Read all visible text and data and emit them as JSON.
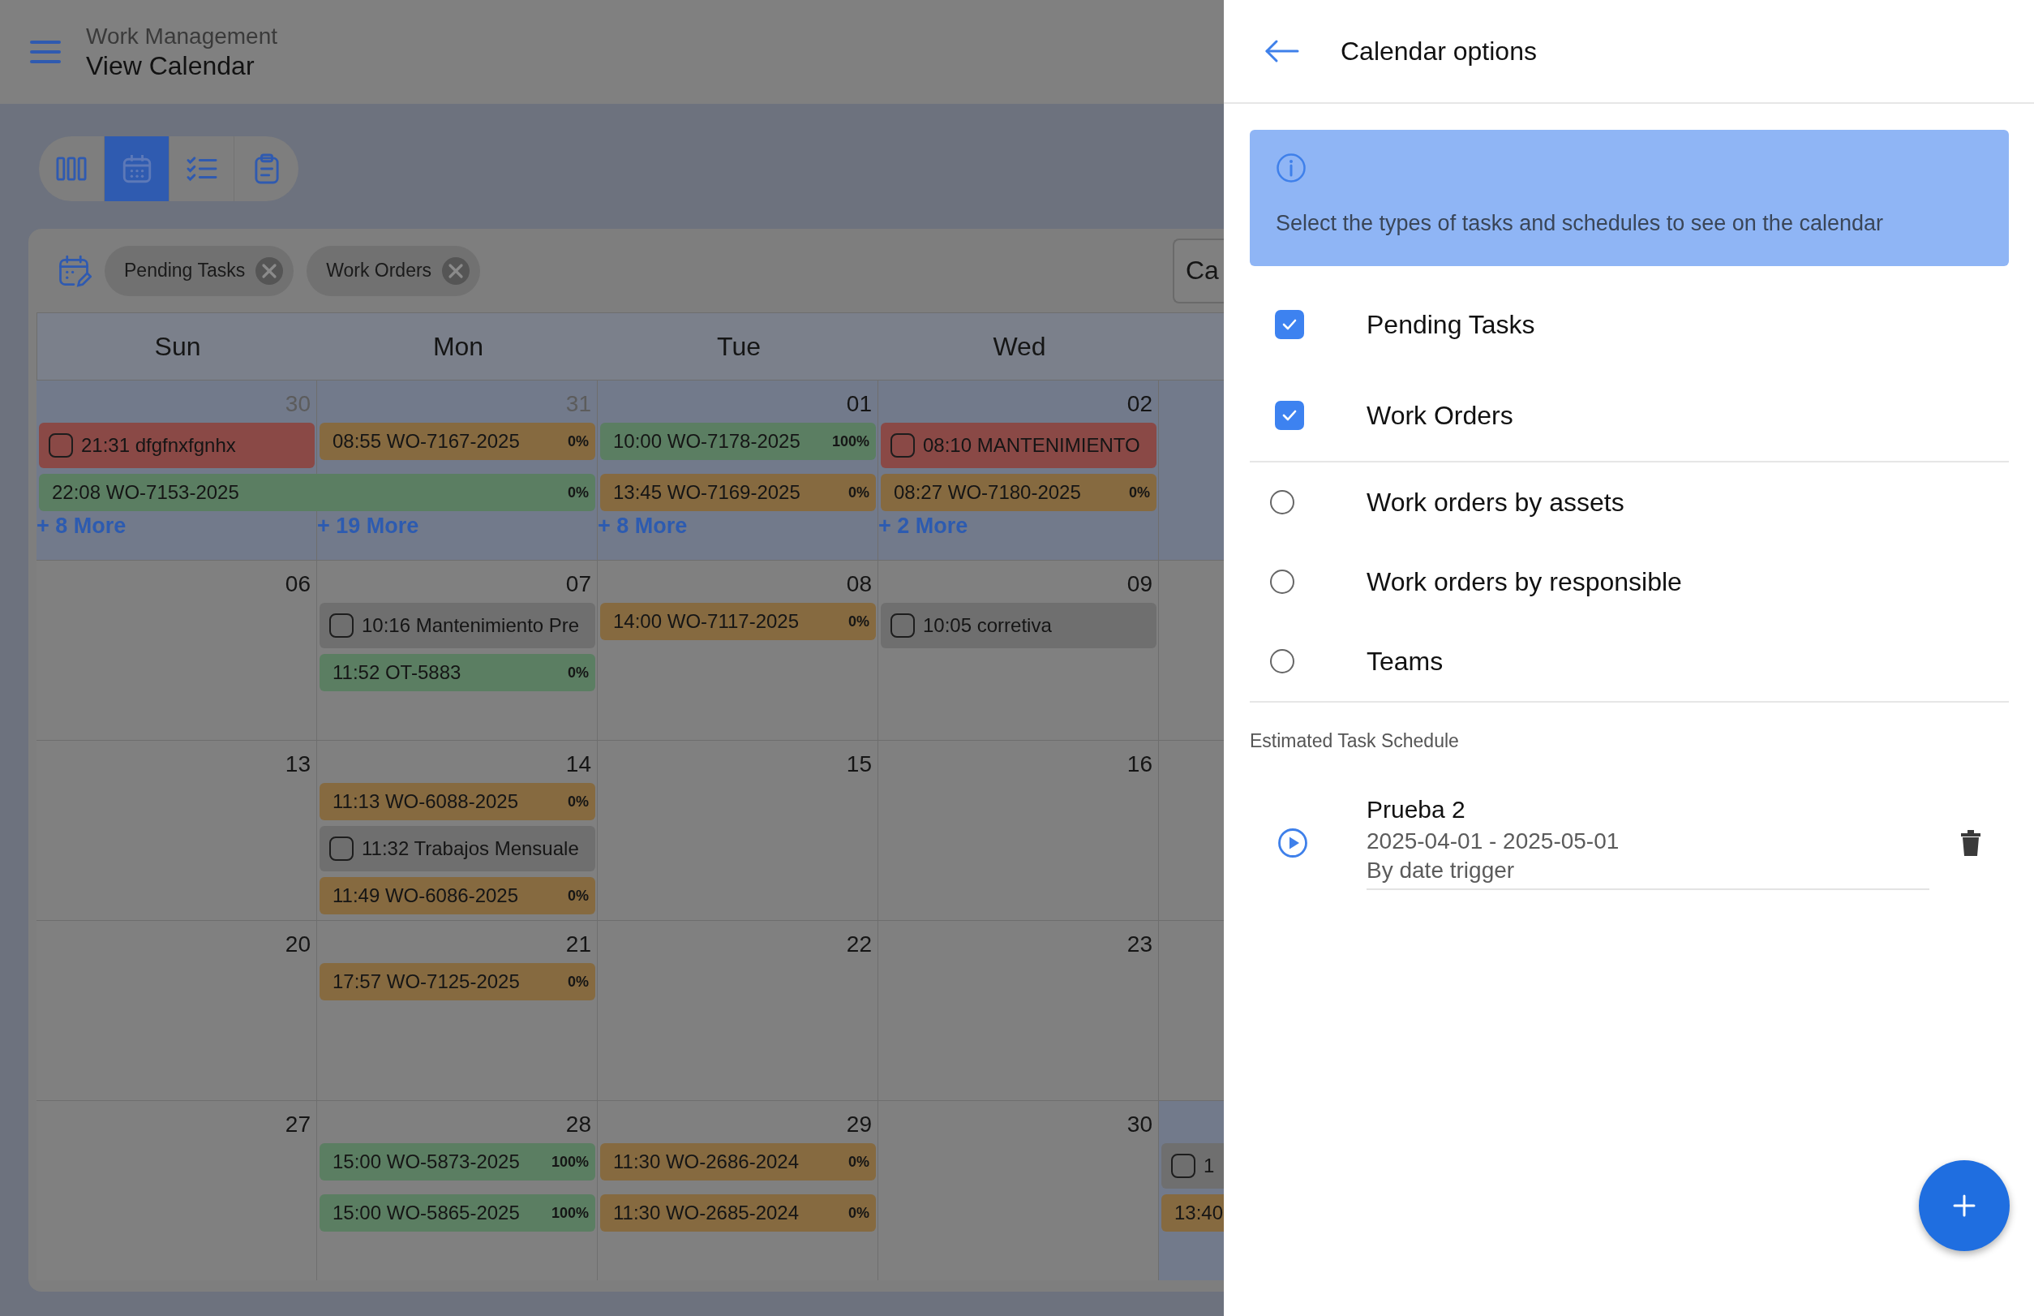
{
  "header": {
    "app": "Work Management",
    "title": "View Calendar"
  },
  "view_modes": [
    {
      "kind": "columns",
      "selected": false
    },
    {
      "kind": "calendar",
      "selected": true
    },
    {
      "kind": "checklist",
      "selected": false
    },
    {
      "kind": "clipboard",
      "selected": false
    }
  ],
  "filters": {
    "chips": [
      {
        "label": "Pending Tasks"
      },
      {
        "label": "Work Orders"
      }
    ],
    "button": "Ca"
  },
  "calendar": {
    "weekdays": [
      "Sun",
      "Mon",
      "Tue",
      "Wed"
    ],
    "weeks": [
      {
        "days": [
          {
            "date": "30",
            "muted": true,
            "shaded": true,
            "more": "+ 8 More",
            "events": [
              {
                "kind": "task",
                "text": "21:31 dfgfnxfgnhx",
                "color": "#8a4946"
              },
              {
                "kind": "order",
                "text": "22:08 WO-7153-2025",
                "progress": "0%",
                "color": "#5b7e62",
                "multi_day": true
              }
            ]
          },
          {
            "date": "31",
            "muted": true,
            "shaded": true,
            "more": "+ 19 More",
            "events": [
              {
                "kind": "order",
                "text": "08:55 WO-7167-2025",
                "progress": "0%",
                "color": "#866a40"
              }
            ]
          },
          {
            "date": "01",
            "muted": false,
            "shaded": true,
            "more": "+ 8 More",
            "events": [
              {
                "kind": "order",
                "text": "10:00 WO-7178-2025",
                "progress": "100%",
                "color": "#5b7e62"
              },
              {
                "kind": "order",
                "text": "13:45 WO-7169-2025",
                "progress": "0%",
                "color": "#866a40"
              }
            ]
          },
          {
            "date": "02",
            "muted": false,
            "shaded": true,
            "more": "+ 2 More",
            "events": [
              {
                "kind": "task",
                "text": "08:10 MANTENIMIENTO",
                "color": "#8a4946"
              },
              {
                "kind": "order",
                "text": "08:27 WO-7180-2025",
                "progress": "0%",
                "color": "#866a40"
              }
            ]
          },
          {
            "shaded": true
          }
        ]
      },
      {
        "days": [
          {
            "date": "06",
            "muted": false,
            "shaded": false
          },
          {
            "date": "07",
            "muted": false,
            "shaded": false,
            "events": [
              {
                "kind": "task",
                "text": "10:16 Mantenimiento Pre",
                "color": "#6f6f6f"
              },
              {
                "kind": "order",
                "text": "11:52 OT-5883",
                "progress": "0%",
                "color": "#5b7e62"
              }
            ]
          },
          {
            "date": "08",
            "muted": false,
            "shaded": false,
            "events": [
              {
                "kind": "order",
                "text": "14:00 WO-7117-2025",
                "progress": "0%",
                "color": "#866a40"
              }
            ]
          },
          {
            "date": "09",
            "muted": false,
            "shaded": false,
            "events": [
              {
                "kind": "task",
                "text": "10:05 corretiva",
                "color": "#6f6f6f"
              }
            ]
          }
        ]
      },
      {
        "days": [
          {
            "date": "13",
            "muted": false,
            "shaded": false
          },
          {
            "date": "14",
            "muted": false,
            "shaded": false,
            "events": [
              {
                "kind": "order",
                "text": "11:13 WO-6088-2025",
                "progress": "0%",
                "color": "#866a40"
              },
              {
                "kind": "task",
                "text": "11:32 Trabajos Mensuale",
                "color": "#6f6f6f"
              },
              {
                "kind": "order",
                "text": "11:49 WO-6086-2025",
                "progress": "0%",
                "color": "#866a40"
              }
            ]
          },
          {
            "date": "15",
            "muted": false,
            "shaded": false
          },
          {
            "date": "16",
            "muted": false,
            "shaded": false
          }
        ]
      },
      {
        "days": [
          {
            "date": "20",
            "muted": false,
            "shaded": false
          },
          {
            "date": "21",
            "muted": false,
            "shaded": false,
            "events": [
              {
                "kind": "order",
                "text": "17:57 WO-7125-2025",
                "progress": "0%",
                "color": "#866a40"
              }
            ]
          },
          {
            "date": "22",
            "muted": false,
            "shaded": false
          },
          {
            "date": "23",
            "muted": false,
            "shaded": false
          }
        ]
      },
      {
        "days": [
          {
            "date": "27",
            "muted": false,
            "shaded": false
          },
          {
            "date": "28",
            "muted": false,
            "shaded": false,
            "events": [
              {
                "kind": "order",
                "text": "15:00 WO-5873-2025",
                "progress": "100%",
                "color": "#5b7e62"
              },
              {
                "kind": "order",
                "text": "15:00 WO-5865-2025",
                "progress": "100%",
                "color": "#5b7e62"
              }
            ]
          },
          {
            "date": "29",
            "muted": false,
            "shaded": false,
            "events": [
              {
                "kind": "order",
                "text": "11:30 WO-2686-2024",
                "progress": "0%",
                "color": "#866a40"
              },
              {
                "kind": "order",
                "text": "11:30 WO-2685-2024",
                "progress": "0%",
                "color": "#866a40"
              }
            ]
          },
          {
            "date": "30",
            "muted": false,
            "shaded": false
          },
          {
            "shaded": true,
            "events": [
              {
                "kind": "task",
                "text": "1",
                "color": "#6f6f6f"
              },
              {
                "kind": "order",
                "text": "13:40",
                "color": "#866a40"
              }
            ]
          }
        ]
      }
    ]
  },
  "drawer": {
    "title": "Calendar options",
    "info": "Select the types of tasks and schedules to see on the calendar",
    "options": [
      {
        "kind": "checkbox",
        "label": "Pending Tasks",
        "checked": true
      },
      {
        "kind": "checkbox",
        "label": "Work Orders",
        "checked": true
      },
      {
        "kind": "radio",
        "label": "Work orders by assets",
        "selected": false
      },
      {
        "kind": "radio",
        "label": "Work orders by responsible",
        "selected": false
      },
      {
        "kind": "radio",
        "label": "Teams",
        "selected": false
      }
    ],
    "section": "Estimated Task Schedule",
    "schedules": [
      {
        "name": "Prueba 2",
        "dates": "2025-04-01 - 2025-05-01",
        "trigger": "By date trigger"
      }
    ]
  }
}
